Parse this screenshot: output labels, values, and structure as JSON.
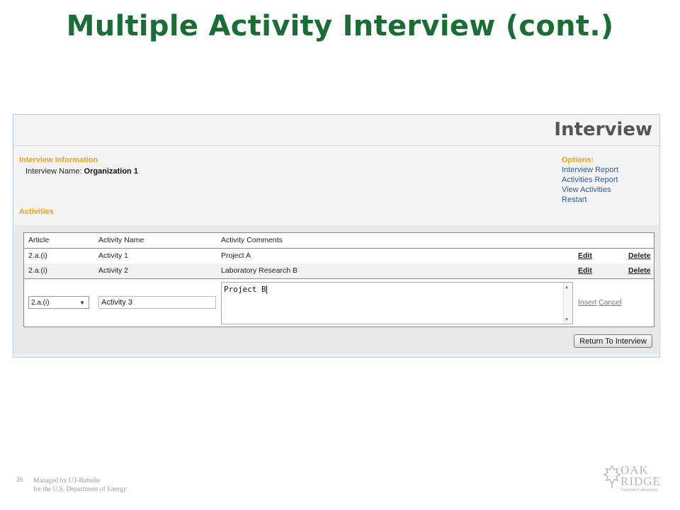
{
  "slide": {
    "title": "Multiple Activity Interview (cont.)",
    "page_number": "26",
    "footer_line1": "Managed by UT-Battelle",
    "footer_line2": "for the U.S. Department of Energy",
    "logo_line1": "OAK",
    "logo_line2": "RIDGE",
    "logo_line3": "National Laboratory"
  },
  "app": {
    "title": "Interview",
    "info_title": "Interview Information",
    "interview_name_label": "Interview Name:",
    "interview_name_value": "Organization 1",
    "activities_title": "Activities",
    "options": {
      "title": "Options:",
      "links": [
        "Interview Report",
        "Activities Report",
        "View Activities",
        "Restart"
      ]
    },
    "grid": {
      "columns": [
        "Article",
        "Activity Name",
        "Activity Comments"
      ],
      "rows": [
        {
          "article": "2.a.(i)",
          "name": "Activity 1",
          "comment": "Project A",
          "edit": "Edit",
          "delete": "Delete"
        },
        {
          "article": "2.a.(i)",
          "name": "Activity 2",
          "comment": "Laboratory Research B",
          "edit": "Edit",
          "delete": "Delete"
        }
      ],
      "new_row": {
        "article_selected": "2.a.(i)",
        "name_value": "Activity 3",
        "comment_value": "Project B",
        "insert": "Insert",
        "cancel": "Cancel"
      }
    },
    "return_button": "Return To Interview"
  },
  "colors": {
    "title_green": "#1a6e35",
    "section_orange": "#f0a020",
    "link_blue": "#2b5d9a"
  },
  "icons": {
    "dropdown": "chevron-down-icon",
    "scroll_up": "scroll-up-icon",
    "scroll_down": "scroll-down-icon",
    "logo": "oak-leaf-logo-icon"
  }
}
